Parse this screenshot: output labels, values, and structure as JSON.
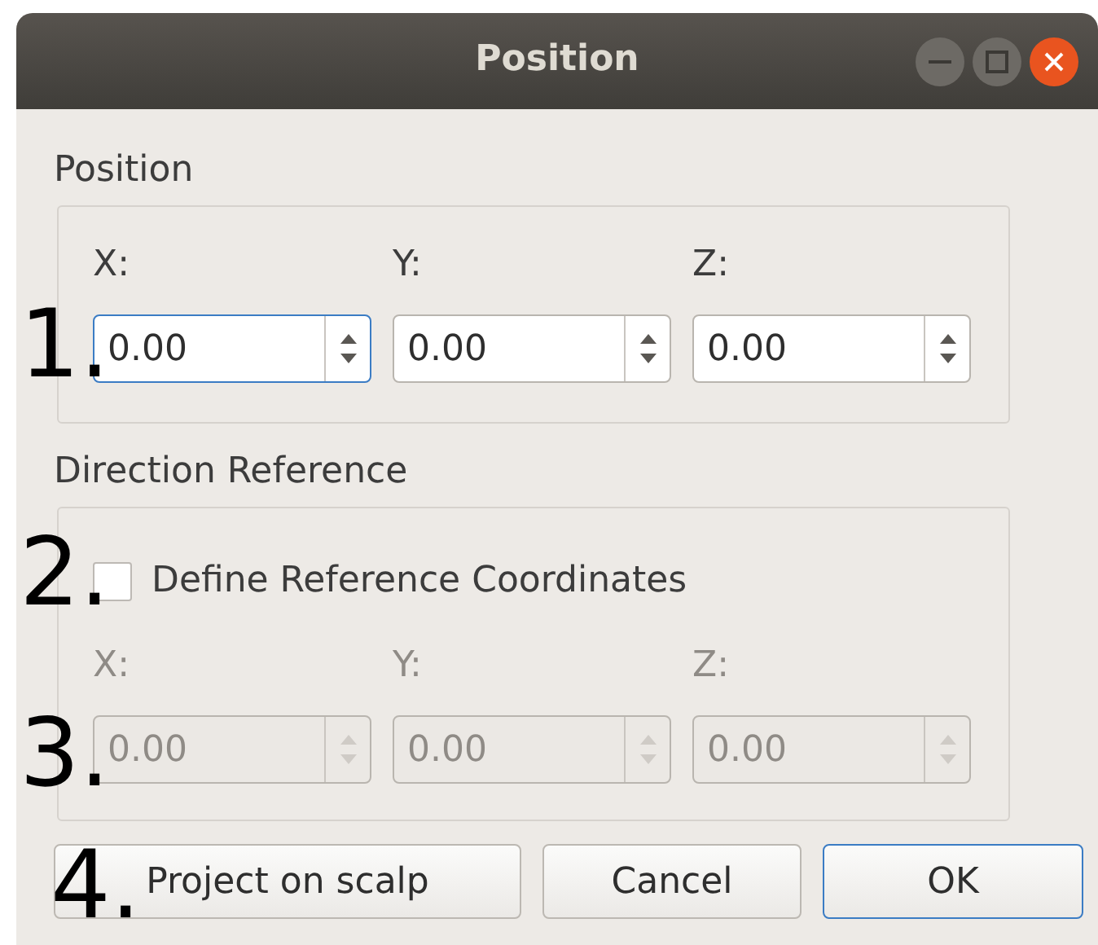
{
  "window": {
    "title": "Position"
  },
  "position_group": {
    "label": "Position",
    "callout": "1.",
    "fields": [
      {
        "label": "X:",
        "value": "0.00",
        "focused": true,
        "disabled": false
      },
      {
        "label": "Y:",
        "value": "0.00",
        "focused": false,
        "disabled": false
      },
      {
        "label": "Z:",
        "value": "0.00",
        "focused": false,
        "disabled": false
      }
    ]
  },
  "direction_group": {
    "label": "Direction Reference",
    "checkbox": {
      "label": "Define Reference Coordinates",
      "checked": false,
      "callout": "2."
    },
    "callout": "3.",
    "fields": [
      {
        "label": "X:",
        "value": "0.00",
        "focused": false,
        "disabled": true
      },
      {
        "label": "Y:",
        "value": "0.00",
        "focused": false,
        "disabled": true
      },
      {
        "label": "Z:",
        "value": "0.00",
        "focused": false,
        "disabled": true
      }
    ]
  },
  "buttons_callout": "4.",
  "buttons": [
    {
      "label": "Project on scalp",
      "default": false
    },
    {
      "label": "Cancel",
      "default": false
    },
    {
      "label": "OK",
      "default": true
    }
  ]
}
